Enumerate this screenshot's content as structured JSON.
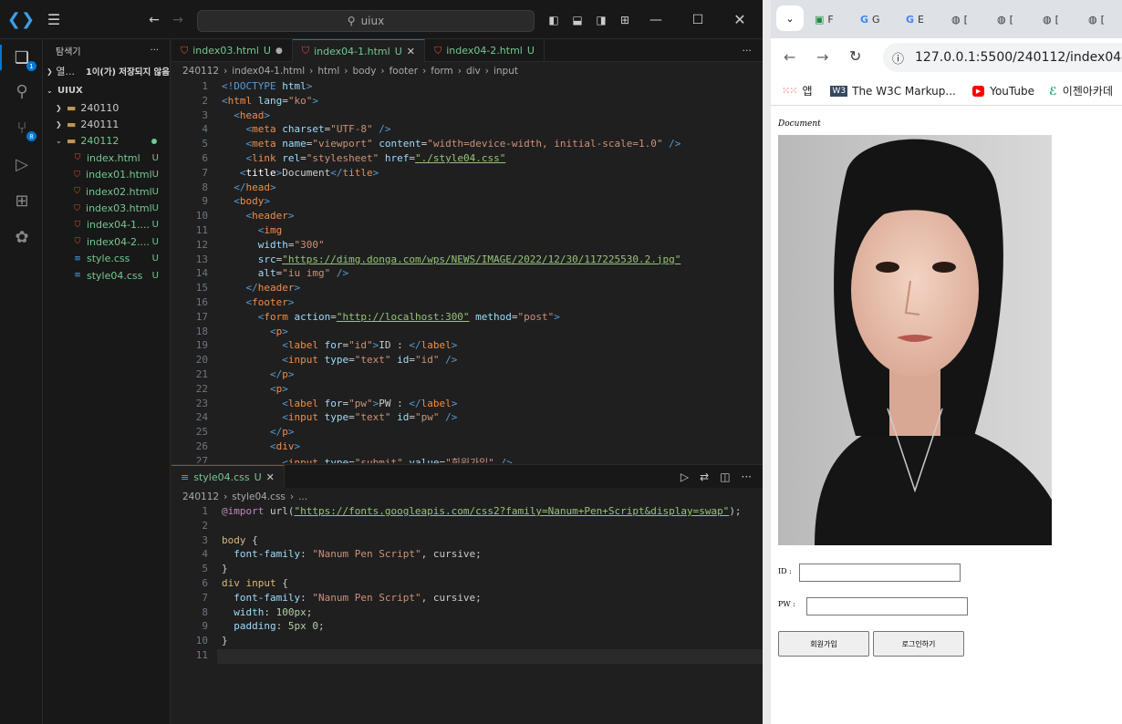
{
  "titlebar": {
    "search_text": "uiux"
  },
  "activity": {
    "explorer_badge": "1",
    "scm_badge": "8"
  },
  "explorer": {
    "title": "탐색기",
    "more": "···",
    "open_editors": {
      "label": "열...",
      "status": "1이(가) 저장되지 않음"
    },
    "workspace": "UIUX",
    "folders": [
      {
        "name": "240110"
      },
      {
        "name": "240111"
      },
      {
        "name": "240112"
      }
    ],
    "files": [
      {
        "name": "index.html",
        "status": "U",
        "type": "html"
      },
      {
        "name": "index01.html",
        "status": "U",
        "type": "html"
      },
      {
        "name": "index02.html",
        "status": "U",
        "type": "html"
      },
      {
        "name": "index03.html",
        "status": "U",
        "type": "html"
      },
      {
        "name": "index04-1....",
        "status": "U",
        "type": "html"
      },
      {
        "name": "index04-2....",
        "status": "U",
        "type": "html"
      },
      {
        "name": "style.css",
        "status": "U",
        "type": "css"
      },
      {
        "name": "style04.css",
        "status": "U",
        "type": "css"
      }
    ]
  },
  "editor1": {
    "tabs": [
      {
        "name": "index03.html",
        "status": "U"
      },
      {
        "name": "index04-1.html",
        "status": "U"
      },
      {
        "name": "index04-2.html",
        "status": "U"
      }
    ],
    "breadcrumb": [
      "240112",
      "index04-1.html",
      "html",
      "body",
      "footer",
      "form",
      "div",
      "input"
    ],
    "line_numbers": [
      "1",
      "2",
      "3",
      "4",
      "5",
      "6",
      "7",
      "8",
      "9",
      "10",
      "11",
      "12",
      "13",
      "14",
      "15",
      "16",
      "17",
      "18",
      "19",
      "20",
      "21",
      "22",
      "23",
      "24",
      "25",
      "26",
      "27"
    ]
  },
  "editor2": {
    "tab": {
      "name": "style04.css",
      "status": "U"
    },
    "breadcrumb": [
      "240112",
      "style04.css",
      "..."
    ],
    "line_numbers": [
      "1",
      "2",
      "3",
      "4",
      "5",
      "6",
      "7",
      "8",
      "9",
      "10",
      "11"
    ]
  },
  "code1": [
    [
      [
        "t",
        "<!DOCTYPE "
      ],
      [
        "at",
        "html"
      ],
      [
        "t",
        ">"
      ]
    ],
    [
      [
        "t",
        "<"
      ],
      [
        "tg",
        "html"
      ],
      [
        "at",
        " lang"
      ],
      [
        "c",
        "="
      ],
      [
        "st",
        "\"ko\""
      ],
      [
        "t",
        ">"
      ]
    ],
    [
      [
        "c",
        "  "
      ],
      [
        "t",
        "<"
      ],
      [
        "tg",
        "head"
      ],
      [
        "t",
        ">"
      ]
    ],
    [
      [
        "c",
        "    "
      ],
      [
        "t",
        "<"
      ],
      [
        "tg",
        "meta"
      ],
      [
        "at",
        " charset"
      ],
      [
        "c",
        "="
      ],
      [
        "st",
        "\"UTF-8\""
      ],
      [
        "t",
        " />"
      ]
    ],
    [
      [
        "c",
        "    "
      ],
      [
        "t",
        "<"
      ],
      [
        "tg",
        "meta"
      ],
      [
        "at",
        " name"
      ],
      [
        "c",
        "="
      ],
      [
        "st",
        "\"viewport\""
      ],
      [
        "at",
        " content"
      ],
      [
        "c",
        "="
      ],
      [
        "st",
        "\"width=device-width, initial-scale=1.0\""
      ],
      [
        "t",
        " />"
      ]
    ],
    [
      [
        "c",
        "    "
      ],
      [
        "t",
        "<"
      ],
      [
        "tg",
        "link"
      ],
      [
        "at",
        " rel"
      ],
      [
        "c",
        "="
      ],
      [
        "st",
        "\"stylesheet\""
      ],
      [
        "at",
        " href"
      ],
      [
        "c",
        "="
      ],
      [
        "sg",
        "\"./style04.css\""
      ]
    ],
    [
      [
        "c",
        "   "
      ],
      [
        "t",
        "<"
      ],
      [
        "w",
        "title"
      ],
      [
        "t",
        ">"
      ],
      [
        "c",
        "Document"
      ],
      [
        "t",
        "</"
      ],
      [
        "tg",
        "title"
      ],
      [
        "t",
        ">"
      ]
    ],
    [
      [
        "c",
        "  "
      ],
      [
        "t",
        "</"
      ],
      [
        "tg",
        "head"
      ],
      [
        "t",
        ">"
      ]
    ],
    [
      [
        "c",
        "  "
      ],
      [
        "t",
        "<"
      ],
      [
        "tg",
        "body"
      ],
      [
        "t",
        ">"
      ]
    ],
    [
      [
        "c",
        "    "
      ],
      [
        "t",
        "<"
      ],
      [
        "tg",
        "header"
      ],
      [
        "t",
        ">"
      ]
    ],
    [
      [
        "c",
        "      "
      ],
      [
        "t",
        "<"
      ],
      [
        "tg",
        "img"
      ]
    ],
    [
      [
        "c",
        "      "
      ],
      [
        "at",
        "width"
      ],
      [
        "c",
        "="
      ],
      [
        "st",
        "\"300\""
      ]
    ],
    [
      [
        "c",
        "      "
      ],
      [
        "at",
        "src"
      ],
      [
        "c",
        "="
      ],
      [
        "sg",
        "\"https://dimg.donga.com/wps/NEWS/IMAGE/2022/12/30/117225530.2.jpg\""
      ]
    ],
    [
      [
        "c",
        "      "
      ],
      [
        "at",
        "alt"
      ],
      [
        "c",
        "="
      ],
      [
        "st",
        "\"iu img\""
      ],
      [
        "t",
        " />"
      ]
    ],
    [
      [
        "c",
        "    "
      ],
      [
        "t",
        "</"
      ],
      [
        "tg",
        "header"
      ],
      [
        "t",
        ">"
      ]
    ],
    [
      [
        "c",
        "    "
      ],
      [
        "t",
        "<"
      ],
      [
        "tg",
        "footer"
      ],
      [
        "t",
        ">"
      ]
    ],
    [
      [
        "c",
        "      "
      ],
      [
        "t",
        "<"
      ],
      [
        "tg",
        "form"
      ],
      [
        "at",
        " action"
      ],
      [
        "c",
        "="
      ],
      [
        "sg",
        "\"http://localhost:300\""
      ],
      [
        "at",
        " method"
      ],
      [
        "c",
        "="
      ],
      [
        "st",
        "\"post\""
      ],
      [
        "t",
        ">"
      ]
    ],
    [
      [
        "c",
        "        "
      ],
      [
        "t",
        "<"
      ],
      [
        "tg",
        "p"
      ],
      [
        "t",
        ">"
      ]
    ],
    [
      [
        "c",
        "          "
      ],
      [
        "t",
        "<"
      ],
      [
        "tg",
        "label"
      ],
      [
        "at",
        " for"
      ],
      [
        "c",
        "="
      ],
      [
        "st",
        "\"id\""
      ],
      [
        "t",
        ">"
      ],
      [
        "c",
        "ID : "
      ],
      [
        "t",
        "</"
      ],
      [
        "tg",
        "label"
      ],
      [
        "t",
        ">"
      ]
    ],
    [
      [
        "c",
        "          "
      ],
      [
        "t",
        "<"
      ],
      [
        "tg",
        "input"
      ],
      [
        "at",
        " type"
      ],
      [
        "c",
        "="
      ],
      [
        "st",
        "\"text\""
      ],
      [
        "at",
        " id"
      ],
      [
        "c",
        "="
      ],
      [
        "st",
        "\"id\""
      ],
      [
        "t",
        " />"
      ]
    ],
    [
      [
        "c",
        "        "
      ],
      [
        "t",
        "</"
      ],
      [
        "tg",
        "p"
      ],
      [
        "t",
        ">"
      ]
    ],
    [
      [
        "c",
        "        "
      ],
      [
        "t",
        "<"
      ],
      [
        "tg",
        "p"
      ],
      [
        "t",
        ">"
      ]
    ],
    [
      [
        "c",
        "          "
      ],
      [
        "t",
        "<"
      ],
      [
        "tg",
        "label"
      ],
      [
        "at",
        " for"
      ],
      [
        "c",
        "="
      ],
      [
        "st",
        "\"pw\""
      ],
      [
        "t",
        ">"
      ],
      [
        "c",
        "PW : "
      ],
      [
        "t",
        "</"
      ],
      [
        "tg",
        "label"
      ],
      [
        "t",
        ">"
      ]
    ],
    [
      [
        "c",
        "          "
      ],
      [
        "t",
        "<"
      ],
      [
        "tg",
        "input"
      ],
      [
        "at",
        " type"
      ],
      [
        "c",
        "="
      ],
      [
        "st",
        "\"text\""
      ],
      [
        "at",
        " id"
      ],
      [
        "c",
        "="
      ],
      [
        "st",
        "\"pw\""
      ],
      [
        "t",
        " />"
      ]
    ],
    [
      [
        "c",
        "        "
      ],
      [
        "t",
        "</"
      ],
      [
        "tg",
        "p"
      ],
      [
        "t",
        ">"
      ]
    ],
    [
      [
        "c",
        "        "
      ],
      [
        "t",
        "<"
      ],
      [
        "tg",
        "div"
      ],
      [
        "t",
        ">"
      ]
    ],
    [
      [
        "c",
        "          "
      ],
      [
        "t",
        "<"
      ],
      [
        "tg",
        "input"
      ],
      [
        "at",
        " type"
      ],
      [
        "c",
        "="
      ],
      [
        "st",
        "\"submit\""
      ],
      [
        "at",
        " value"
      ],
      [
        "c",
        "="
      ],
      [
        "st",
        "\"회원가입\""
      ],
      [
        "t",
        " />"
      ]
    ]
  ],
  "code2": [
    [
      [
        "kw",
        "@import "
      ],
      [
        "c",
        "url("
      ],
      [
        "sg",
        "\"https://fonts.googleapis.com/css2?family=Nanum+Pen+Script&display=swap\""
      ],
      [
        "c",
        ");"
      ]
    ],
    [
      [
        "c",
        ""
      ]
    ],
    [
      [
        "sel",
        "body"
      ],
      [
        "c",
        " {"
      ]
    ],
    [
      [
        "c",
        "  "
      ],
      [
        "pr",
        "font-family"
      ],
      [
        "c",
        ": "
      ],
      [
        "st",
        "\"Nanum Pen Script\""
      ],
      [
        "c",
        ", cursive;"
      ]
    ],
    [
      [
        "c",
        "}"
      ]
    ],
    [
      [
        "sel",
        "div input"
      ],
      [
        "c",
        " {"
      ]
    ],
    [
      [
        "c",
        "  "
      ],
      [
        "pr",
        "font-family"
      ],
      [
        "c",
        ": "
      ],
      [
        "st",
        "\"Nanum Pen Script\""
      ],
      [
        "c",
        ", cursive;"
      ]
    ],
    [
      [
        "c",
        "  "
      ],
      [
        "pr",
        "width"
      ],
      [
        "c",
        ": "
      ],
      [
        "nm",
        "100px"
      ],
      [
        "c",
        ";"
      ]
    ],
    [
      [
        "c",
        "  "
      ],
      [
        "pr",
        "padding"
      ],
      [
        "c",
        ": "
      ],
      [
        "nm",
        "5px 0"
      ],
      [
        "c",
        ";"
      ]
    ],
    [
      [
        "c",
        "}"
      ]
    ],
    [
      [
        "c",
        ""
      ]
    ]
  ],
  "browser": {
    "url": "127.0.0.1:5500/240112/index04-1.htm",
    "bookmarks": [
      {
        "label": "앱"
      },
      {
        "label": "The W3C Markup..."
      },
      {
        "label": "YouTube"
      },
      {
        "label": "이젠아카데"
      }
    ],
    "tab_labels": [
      "F",
      "G",
      "E",
      "[",
      "[",
      "[",
      "["
    ],
    "page": {
      "title": "Document",
      "id_label": "ID :",
      "pw_label": "PW :",
      "submit": "회원가입",
      "reset": "로그인하기"
    },
    "image_alt": "iu img"
  },
  "colors": {
    "vscode_bg": "#1f1f1f",
    "accent": "#0078d4",
    "untracked": "#73c991"
  }
}
